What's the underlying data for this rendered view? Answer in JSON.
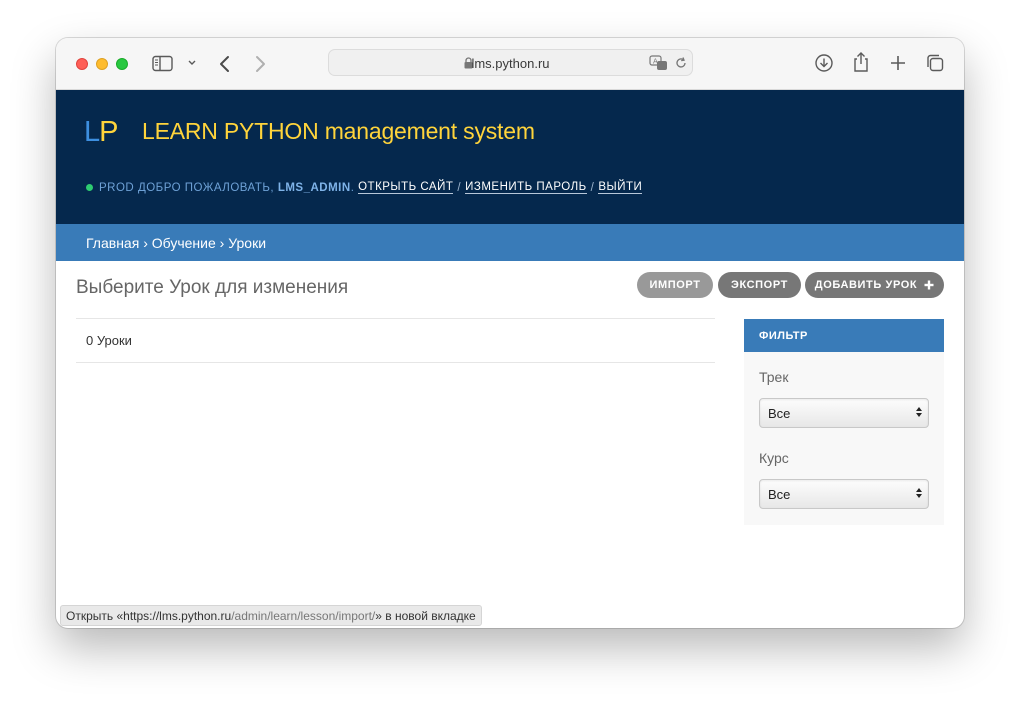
{
  "browser": {
    "url": "lms.python.ru"
  },
  "header": {
    "logo_l": "L",
    "logo_p": "P",
    "brand": "LEARN PYTHON management system",
    "env": "PROD",
    "welcome": "ДОБРО ПОЖАЛОВАТЬ,",
    "username": "LMS_ADMIN",
    "view_site": "ОТКРЫТЬ САЙТ",
    "change_password": "ИЗМЕНИТЬ ПАРОЛЬ",
    "logout": "ВЫЙТИ",
    "separator": "/"
  },
  "breadcrumbs": {
    "home": "Главная",
    "app": "Обучение",
    "model": "Уроки",
    "separator": "›"
  },
  "content": {
    "title": "Выберите Урок для изменения",
    "count_text": "0 Уроки"
  },
  "object_tools": {
    "import": "ИМПОРТ",
    "export": "ЭКСПОРТ",
    "add": "ДОБАВИТЬ УРОК"
  },
  "filter": {
    "title": "ФИЛЬТР",
    "track_label": "Трек",
    "track_value": "Все",
    "course_label": "Курс",
    "course_value": "Все"
  },
  "status_bar": {
    "prefix": "Открыть «",
    "url_host": "https://lms.python.ru",
    "url_path": "/admin/learn/lesson/import/",
    "suffix": "» в новой вкладке"
  }
}
